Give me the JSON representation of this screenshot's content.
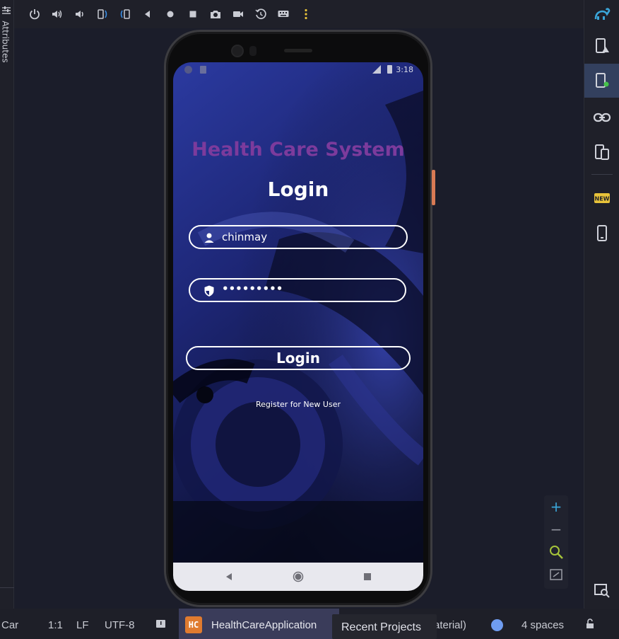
{
  "left_panel": {
    "label": "Attributes",
    "icon": "sliders-icon"
  },
  "toolbar": {
    "buttons": [
      {
        "name": "power-icon"
      },
      {
        "name": "volume-up-icon"
      },
      {
        "name": "volume-down-icon"
      },
      {
        "name": "rotate-left-icon"
      },
      {
        "name": "rotate-right-icon"
      },
      {
        "name": "back-icon"
      },
      {
        "name": "home-icon"
      },
      {
        "name": "overview-icon"
      },
      {
        "name": "camera-icon"
      },
      {
        "name": "record-icon"
      },
      {
        "name": "snapshot-icon"
      },
      {
        "name": "keyboard-icon"
      },
      {
        "name": "more-icon"
      }
    ]
  },
  "device": {
    "status_time": "3:18",
    "app_title": "Health Care System",
    "login_heading": "Login",
    "username_value": "chinmay",
    "password_value": "•••••••••",
    "login_button": "Login",
    "register_link": "Register for New User",
    "title_color": "#7c3b9c"
  },
  "right_panel": {
    "buttons": [
      {
        "name": "gradle-icon"
      },
      {
        "name": "device-manager-icon"
      },
      {
        "name": "running-devices-icon"
      },
      {
        "name": "link-icon"
      },
      {
        "name": "device-mirroring-icon"
      },
      {
        "name": "new-badge-icon",
        "text": "NEW"
      },
      {
        "name": "phone-icon"
      },
      {
        "name": "inspect-icon"
      }
    ]
  },
  "zoom": {
    "zoom_in": "+",
    "zoom_out": "−"
  },
  "status_bar": {
    "context": "Car",
    "position": "1:1",
    "line_ending": "LF",
    "encoding": "UTF-8",
    "project_badge": "HC",
    "project_name": "HealthCareApplication",
    "tooltip": "Recent Projects",
    "theme_suffix": "aterial)",
    "indent": "4 spaces"
  }
}
